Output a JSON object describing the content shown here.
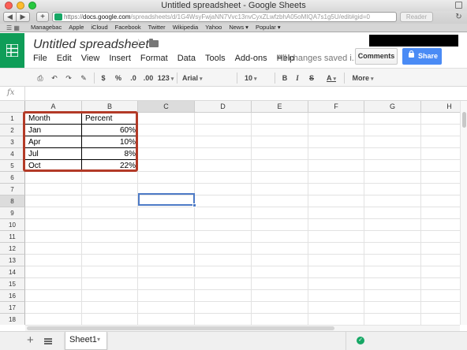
{
  "browser": {
    "window_title": "Untitled spreadsheet - Google Sheets",
    "url_scheme": "https",
    "url_host": "docs.google.com",
    "url_path": "/spreadsheets/d/1G4WsyFwjaNN7Vvc13nvCyxZLwfzbhA05oMIQA7s1g5U/edit#gid=0",
    "reader_label": "Reader",
    "bookmarks": [
      "Managebac",
      "Apple",
      "iCloud",
      "Facebook",
      "Twitter",
      "Wikipedia",
      "Yahoo",
      "News ▾",
      "Popular ▾"
    ]
  },
  "doc": {
    "title": "Untitled spreadsheet",
    "save_status": "All changes saved i...",
    "comments_label": "Comments",
    "share_label": "Share"
  },
  "menu": [
    "File",
    "Edit",
    "View",
    "Insert",
    "Format",
    "Data",
    "Tools",
    "Add-ons",
    "Help"
  ],
  "toolbar": {
    "currency": "$",
    "percent": "%",
    "decrease_decimals": ".0",
    "increase_decimals": ".00",
    "number_format": "123",
    "font": "Arial",
    "font_size": "10",
    "bold": "B",
    "italic": "I",
    "strike": "S",
    "text_color": "A",
    "more": "More"
  },
  "formula_bar": {
    "fx": "fx",
    "value": ""
  },
  "grid": {
    "columns": [
      "A",
      "B",
      "C",
      "D",
      "E",
      "F",
      "G",
      "H"
    ],
    "rows": [
      "1",
      "2",
      "3",
      "4",
      "5",
      "6",
      "7",
      "8",
      "9",
      "10",
      "11",
      "12",
      "13",
      "14",
      "15",
      "16",
      "17",
      "18"
    ],
    "active_column": "C",
    "active_row": "8",
    "cells": [
      {
        "a": "Month",
        "b": "Percent"
      },
      {
        "a": "Jan",
        "b": "60%"
      },
      {
        "a": "Apr",
        "b": "10%"
      },
      {
        "a": "Jul",
        "b": "8%"
      },
      {
        "a": "Oct",
        "b": "22%"
      }
    ]
  },
  "sheets": {
    "tab_label": "Sheet1"
  },
  "colors": {
    "sheets_green": "#0f9d58",
    "share_blue": "#4a8bf5",
    "highlight_red": "#b33a27",
    "selection_blue": "#4d7ac6"
  }
}
